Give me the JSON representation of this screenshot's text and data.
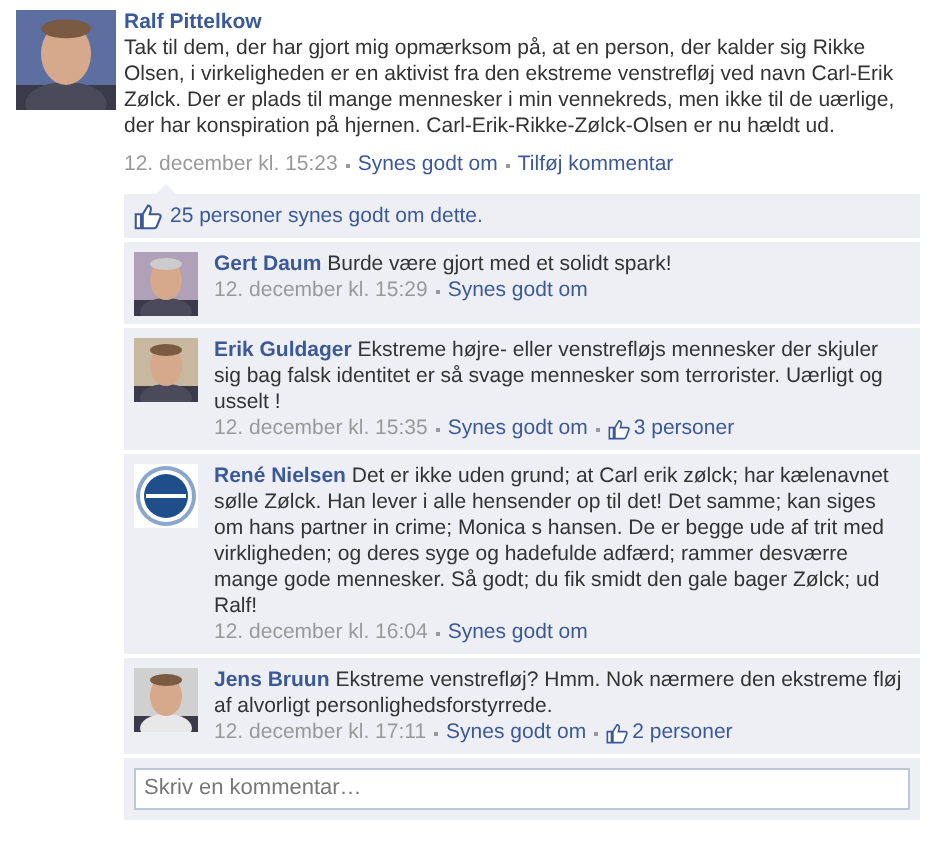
{
  "post": {
    "author": "Ralf Pittelkow",
    "text": "Tak til dem, der har gjort mig opmærksom på, at en person, der kalder sig Rikke Olsen, i virkeligheden er en aktivist fra den ekstreme venstrefløj ved navn Carl-Erik Zølck. Der er plads til mange mennesker i min vennekreds, men ikke til de uærlige, der har konspiration på hjernen. Carl-Erik-Rikke-Zølck-Olsen er nu hældt ud.",
    "time": "12. december kl. 15:23",
    "actions": [
      "Synes godt om",
      "Tilføj kommentar"
    ]
  },
  "likes": {
    "text": "25 personer synes godt om dette."
  },
  "comments": [
    {
      "author": "Gert Daum",
      "text": "Burde være gjort med et solidt spark!",
      "time": "12. december kl. 15:29",
      "like_action": "Synes godt om"
    },
    {
      "author": "Erik Guldager",
      "text": "Ekstreme højre- eller venstrefløjs mennesker der skjuler sig bag falsk identitet er så svage mennesker som terrorister. Uærligt og usselt !",
      "time": "12. december kl. 15:35",
      "like_action": "Synes godt om",
      "likes": "3 personer"
    },
    {
      "author": "René Nielsen",
      "text": "Det er ikke uden grund; at Carl erik zølck; har kælenavnet sølle Zølck. Han lever i alle hensender op til det! Det samme; kan siges om hans partner in crime; Monica s hansen. De er begge ude af trit med virkligheden; og deres syge og hadefulde adfærd; rammer desværre mange gode mennesker. Så godt; du fik smidt den gale bager Zølck; ud Ralf!",
      "time": "12. december kl. 16:04",
      "like_action": "Synes godt om"
    },
    {
      "author": "Jens Bruun",
      "text": "Ekstreme venstrefløj? Hmm. Nok nærmere den ekstreme fløj af alvorligt personlighedsforstyrrede.",
      "time": "12. december kl. 17:11",
      "like_action": "Synes godt om",
      "likes": "2 personer"
    }
  ],
  "comment_input": {
    "placeholder": "Skriv en kommentar…"
  }
}
